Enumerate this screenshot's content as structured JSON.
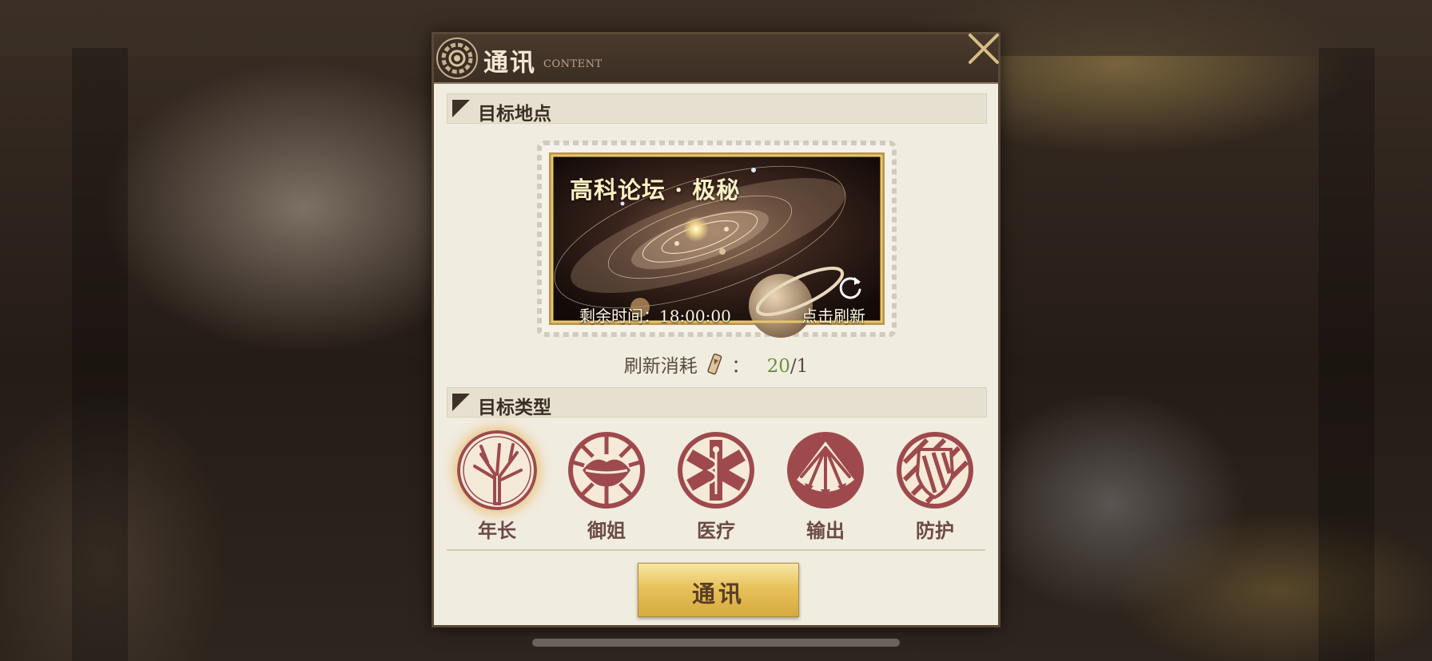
{
  "dialog": {
    "title": "通讯",
    "title_sub": "CONTENT",
    "close_icon": "close-x-icon"
  },
  "target_location": {
    "header": "目标地点",
    "card_title": "高科论坛 · 极秘",
    "remaining_time": "剩余时间：18:00:00",
    "refresh_hint": "点击刷新",
    "refresh_icon": "refresh-icon"
  },
  "refresh_cost": {
    "label": "刷新消耗",
    "separator": "：",
    "current": "20",
    "divider": "/",
    "required": "1",
    "item_icon": "hourglass-scroll-icon"
  },
  "target_type": {
    "header": "目标类型",
    "options": [
      {
        "label": "年长",
        "icon": "tree-icon",
        "selected": true
      },
      {
        "label": "御姐",
        "icon": "lips-icon",
        "selected": false
      },
      {
        "label": "医疗",
        "icon": "medical-cross-icon",
        "selected": false
      },
      {
        "label": "输出",
        "icon": "arrows-icon",
        "selected": false
      },
      {
        "label": "防护",
        "icon": "shield-icon",
        "selected": false
      }
    ]
  },
  "action": {
    "label": "通讯"
  },
  "colors": {
    "panel_bg": "#f1ece0",
    "badge_red": "#9e4a4c",
    "gold": "#e8c25c",
    "cost_green": "#6a8f3b"
  }
}
